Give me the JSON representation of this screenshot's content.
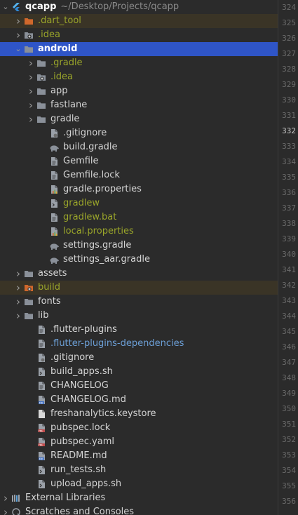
{
  "tree": [
    {
      "label": "qcapp",
      "path": "~/Desktop/Projects/qcapp",
      "indent": 0,
      "arrow": "down",
      "icon": "flutter-icon",
      "style": "bold"
    },
    {
      "label": ".dart_tool",
      "indent": 1,
      "arrow": "right",
      "icon": "folder-orange-icon",
      "style": "green",
      "hl": "brown"
    },
    {
      "label": ".idea",
      "indent": 1,
      "arrow": "right",
      "icon": "folder-gear-icon",
      "style": "green"
    },
    {
      "label": "android",
      "indent": 1,
      "arrow": "down",
      "icon": "folder-icon",
      "style": "sel",
      "hl": "selected"
    },
    {
      "label": ".gradle",
      "indent": 2,
      "arrow": "right",
      "icon": "folder-icon",
      "style": "green"
    },
    {
      "label": ".idea",
      "indent": 2,
      "arrow": "right",
      "icon": "folder-gear-icon",
      "style": "green"
    },
    {
      "label": "app",
      "indent": 2,
      "arrow": "right",
      "icon": "folder-icon",
      "style": "normal"
    },
    {
      "label": "fastlane",
      "indent": 2,
      "arrow": "right",
      "icon": "folder-icon",
      "style": "normal"
    },
    {
      "label": "gradle",
      "indent": 2,
      "arrow": "right",
      "icon": "folder-icon",
      "style": "normal"
    },
    {
      "label": ".gitignore",
      "indent": 3,
      "arrow": "",
      "icon": "gitignore-file-icon",
      "style": "normal"
    },
    {
      "label": "build.gradle",
      "indent": 3,
      "arrow": "",
      "icon": "gradle-elephant-icon",
      "style": "normal"
    },
    {
      "label": "Gemfile",
      "indent": 3,
      "arrow": "",
      "icon": "text-file-icon",
      "style": "normal"
    },
    {
      "label": "Gemfile.lock",
      "indent": 3,
      "arrow": "",
      "icon": "text-file-icon",
      "style": "normal"
    },
    {
      "label": "gradle.properties",
      "indent": 3,
      "arrow": "",
      "icon": "properties-file-icon",
      "style": "normal"
    },
    {
      "label": "gradlew",
      "indent": 3,
      "arrow": "",
      "icon": "shell-file-icon",
      "style": "green"
    },
    {
      "label": "gradlew.bat",
      "indent": 3,
      "arrow": "",
      "icon": "text-file-icon",
      "style": "green"
    },
    {
      "label": "local.properties",
      "indent": 3,
      "arrow": "",
      "icon": "properties-file-icon",
      "style": "green"
    },
    {
      "label": "settings.gradle",
      "indent": 3,
      "arrow": "",
      "icon": "gradle-elephant-icon",
      "style": "normal"
    },
    {
      "label": "settings_aar.gradle",
      "indent": 3,
      "arrow": "",
      "icon": "gradle-elephant-icon",
      "style": "normal"
    },
    {
      "label": "assets",
      "indent": 1,
      "arrow": "right",
      "icon": "folder-icon",
      "style": "normal"
    },
    {
      "label": "build",
      "indent": 1,
      "arrow": "right",
      "icon": "folder-orange-gear-icon",
      "style": "green",
      "hl": "brown"
    },
    {
      "label": "fonts",
      "indent": 1,
      "arrow": "right",
      "icon": "folder-icon",
      "style": "normal"
    },
    {
      "label": "lib",
      "indent": 1,
      "arrow": "right",
      "icon": "folder-icon",
      "style": "normal"
    },
    {
      "label": ".flutter-plugins",
      "indent": 2,
      "arrow": "",
      "icon": "text-file-icon",
      "style": "normal"
    },
    {
      "label": ".flutter-plugins-dependencies",
      "indent": 2,
      "arrow": "",
      "icon": "text-file-icon",
      "style": "blue"
    },
    {
      "label": ".gitignore",
      "indent": 2,
      "arrow": "",
      "icon": "gitignore-file-icon",
      "style": "normal"
    },
    {
      "label": "build_apps.sh",
      "indent": 2,
      "arrow": "",
      "icon": "shell-file-icon",
      "style": "normal"
    },
    {
      "label": "CHANGELOG",
      "indent": 2,
      "arrow": "",
      "icon": "text-file-icon",
      "style": "normal"
    },
    {
      "label": "CHANGELOG.md",
      "indent": 2,
      "arrow": "",
      "icon": "markdown-file-icon",
      "style": "normal"
    },
    {
      "label": "freshanalytics.keystore",
      "indent": 2,
      "arrow": "",
      "icon": "blank-file-icon",
      "style": "normal"
    },
    {
      "label": "pubspec.lock",
      "indent": 2,
      "arrow": "",
      "icon": "yaml-file-icon",
      "style": "normal"
    },
    {
      "label": "pubspec.yaml",
      "indent": 2,
      "arrow": "",
      "icon": "yaml-file-icon",
      "style": "normal"
    },
    {
      "label": "README.md",
      "indent": 2,
      "arrow": "",
      "icon": "markdown-file-icon",
      "style": "normal"
    },
    {
      "label": "run_tests.sh",
      "indent": 2,
      "arrow": "",
      "icon": "shell-file-icon",
      "style": "normal"
    },
    {
      "label": "upload_apps.sh",
      "indent": 2,
      "arrow": "",
      "icon": "shell-file-icon",
      "style": "normal"
    },
    {
      "label": "External Libraries",
      "indent": 0,
      "arrow": "right",
      "icon": "libraries-icon",
      "style": "normal"
    },
    {
      "label": "Scratches and Consoles",
      "indent": 0,
      "arrow": "right",
      "icon": "scratches-icon",
      "style": "normal"
    }
  ],
  "gutter": {
    "lines": [
      "324",
      "325",
      "326",
      "327",
      "328",
      "329",
      "330",
      "331",
      "332",
      "333",
      "334",
      "335",
      "336",
      "337",
      "338",
      "339",
      "340",
      "341",
      "342",
      "343",
      "344",
      "345",
      "346",
      "347",
      "348",
      "349",
      "350",
      "351",
      "352",
      "353",
      "354",
      "355",
      "356"
    ],
    "current": "332"
  },
  "colors": {
    "background": "#2b2b2b",
    "selection": "#2f55c7",
    "excluded_highlight": "#3a3426",
    "ignored_text": "#9aa52a",
    "untracked_text": "#6c9fd6"
  }
}
